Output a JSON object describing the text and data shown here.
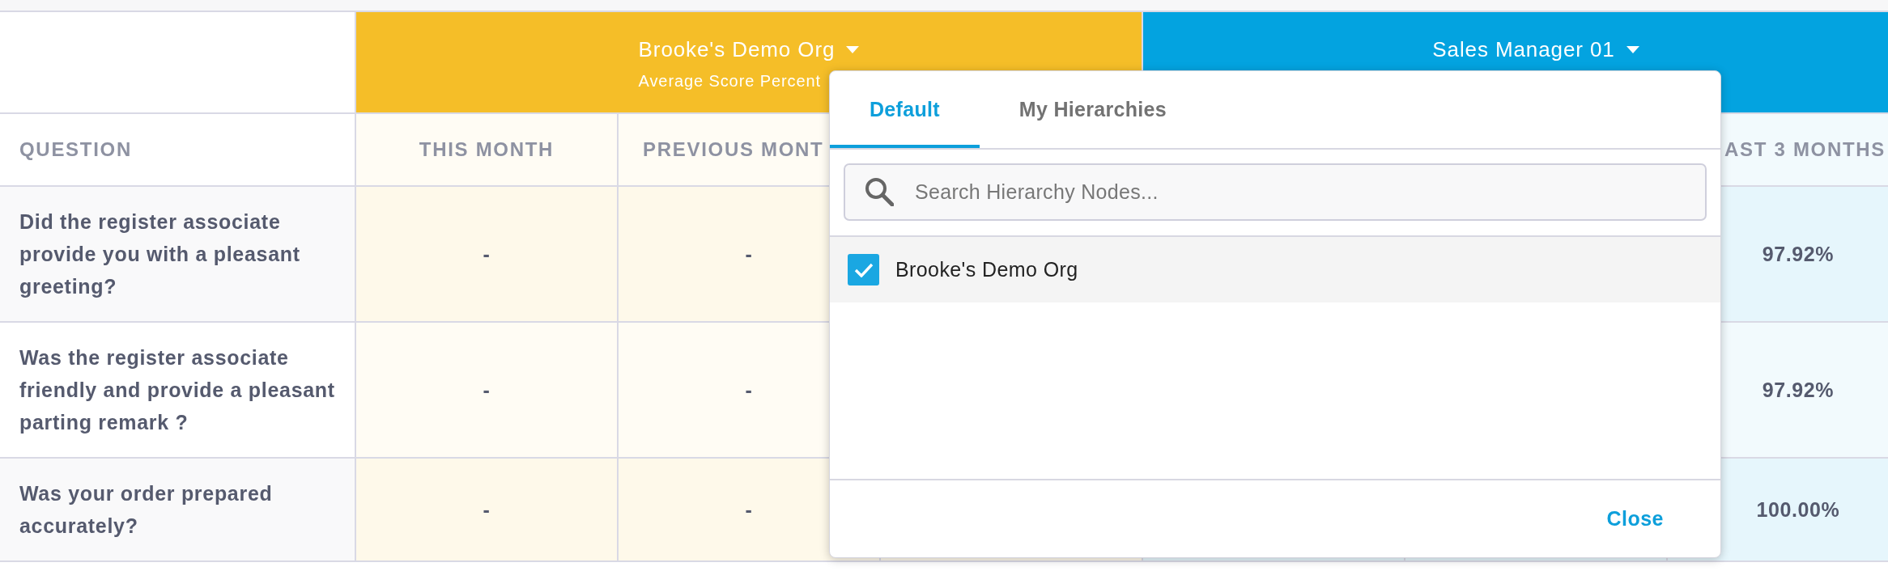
{
  "table": {
    "groups": [
      {
        "title": "Brooke's Demo Org",
        "subtitle": "Average Score Percent",
        "color": "#f5be28"
      },
      {
        "title": "Sales Manager 01",
        "color": "#03a3e0"
      }
    ],
    "column_headers": {
      "column_1": "QUESTION",
      "column_2": "THIS MONTH",
      "column_3": "PREVIOUS MONT",
      "column_7": "AST 3 MONTHS"
    },
    "rows": [
      {
        "question": "Did the register associate provide you with a pleasant greeting?",
        "column_2": "-",
        "column_3": "-",
        "column_7": "97.92%"
      },
      {
        "question": "Was the register associate friendly and provide a pleasant parting remark ?",
        "column_2": "-",
        "column_3": "-",
        "column_7": "97.92%"
      },
      {
        "question": "Was your order prepared accurately?",
        "column_2": "-",
        "column_3": "-",
        "column_7": "100.00%"
      }
    ]
  },
  "hierarchy_picker": {
    "tabs": [
      {
        "label": "Default",
        "selected": true
      },
      {
        "label": "My Hierarchies",
        "selected": false
      }
    ],
    "search": {
      "placeholder": "Search Hierarchy Nodes..."
    },
    "nodes": [
      {
        "label": "Brooke's Demo Org",
        "checked": true
      }
    ],
    "close": "Close"
  }
}
